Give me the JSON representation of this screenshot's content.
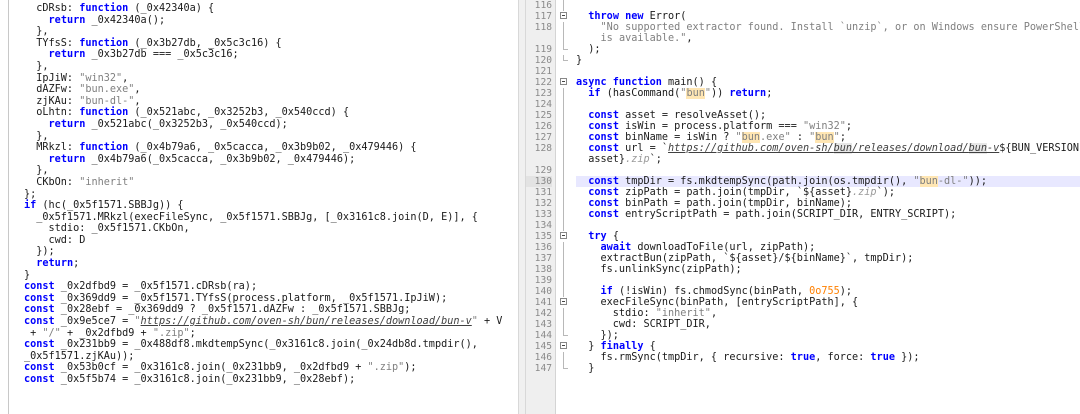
{
  "left_pane": {
    "lines": [
      {
        "seg": [
          {
            "t": "  cDRsb: "
          },
          {
            "t": "function",
            "c": "kw"
          },
          {
            "t": " (_0x42340a) {"
          }
        ]
      },
      {
        "seg": [
          {
            "t": "    "
          },
          {
            "t": "return",
            "c": "kw"
          },
          {
            "t": " _0x42340a();"
          }
        ]
      },
      {
        "seg": [
          {
            "t": "  },"
          }
        ]
      },
      {
        "seg": [
          {
            "t": "  TYfsS: "
          },
          {
            "t": "function",
            "c": "kw"
          },
          {
            "t": " (_0x3b27db, _0x5c3c16) {"
          }
        ]
      },
      {
        "seg": [
          {
            "t": "    "
          },
          {
            "t": "return",
            "c": "kw"
          },
          {
            "t": " _0x3b27db === _0x5c3c16;"
          }
        ]
      },
      {
        "seg": [
          {
            "t": "  },"
          }
        ]
      },
      {
        "seg": [
          {
            "t": "  IpJiW: "
          },
          {
            "t": "\"win32\"",
            "c": "str"
          },
          {
            "t": ","
          }
        ]
      },
      {
        "seg": [
          {
            "t": "  dAZFw: "
          },
          {
            "t": "\"bun.exe\"",
            "c": "str"
          },
          {
            "t": ","
          }
        ]
      },
      {
        "seg": [
          {
            "t": "  zjKAu: "
          },
          {
            "t": "\"bun-dl-\"",
            "c": "str"
          },
          {
            "t": ","
          }
        ]
      },
      {
        "seg": [
          {
            "t": "  oLhtn: "
          },
          {
            "t": "function",
            "c": "kw"
          },
          {
            "t": " (_0x521abc, _0x3252b3, _0x540ccd) {"
          }
        ]
      },
      {
        "seg": [
          {
            "t": "    "
          },
          {
            "t": "return",
            "c": "kw"
          },
          {
            "t": " _0x521abc(_0x3252b3, _0x540ccd);"
          }
        ]
      },
      {
        "seg": [
          {
            "t": "  },"
          }
        ]
      },
      {
        "seg": [
          {
            "t": "  MRkzl: "
          },
          {
            "t": "function",
            "c": "kw"
          },
          {
            "t": " (_0x4b79a6, _0x5cacca, _0x3b9b02, _0x479446) {"
          }
        ]
      },
      {
        "seg": [
          {
            "t": "    "
          },
          {
            "t": "return",
            "c": "kw"
          },
          {
            "t": " _0x4b79a6(_0x5cacca, _0x3b9b02, _0x479446);"
          }
        ]
      },
      {
        "seg": [
          {
            "t": "  },"
          }
        ]
      },
      {
        "seg": [
          {
            "t": "  CKbOn: "
          },
          {
            "t": "\"inherit\"",
            "c": "str"
          }
        ]
      },
      {
        "seg": [
          {
            "t": "};"
          }
        ]
      },
      {
        "seg": [
          {
            "t": "if",
            "c": "kw"
          },
          {
            "t": " (hc(_0x5f1571.SBBJg)) {"
          }
        ]
      },
      {
        "seg": [
          {
            "t": "  _0x5f1571.MRkzl(execFileSync, _0x5f1571.SBBJg, [_0x3161c8.join(D, E)], {"
          }
        ]
      },
      {
        "seg": [
          {
            "t": "    stdio: _0x5f1571.CKbOn,"
          }
        ]
      },
      {
        "seg": [
          {
            "t": "    cwd: D"
          }
        ]
      },
      {
        "seg": [
          {
            "t": "  });"
          }
        ]
      },
      {
        "seg": [
          {
            "t": "  "
          },
          {
            "t": "return",
            "c": "kw"
          },
          {
            "t": ";"
          }
        ]
      },
      {
        "seg": [
          {
            "t": "}"
          }
        ]
      },
      {
        "seg": [
          {
            "t": "const",
            "c": "kw"
          },
          {
            "t": " _0x2dfbd9 = _0x5f1571.cDRsb(ra);"
          }
        ]
      },
      {
        "seg": [
          {
            "t": "const",
            "c": "kw"
          },
          {
            "t": " _0x369dd9 = _0x5f1571.TYfsS(process.platform, _0x5f1571.IpJiW);"
          }
        ]
      },
      {
        "seg": [
          {
            "t": "const",
            "c": "kw"
          },
          {
            "t": " _0x28ebf = _0x369dd9 ? _0x5f1571.dAZFw : _0x5f1571.SBBJg;"
          }
        ]
      },
      {
        "seg": [
          {
            "t": "const",
            "c": "kw"
          },
          {
            "t": " _0x9e5ce7 = "
          },
          {
            "t": "\"",
            "c": "str"
          },
          {
            "t": "https://github.com/oven-sh/bun/releases/download/bun-v",
            "c": "url"
          },
          {
            "t": "\"",
            "c": "str"
          },
          {
            "t": " + V"
          }
        ]
      },
      {
        "seg": [
          {
            "t": " + "
          },
          {
            "t": "\"/\"",
            "c": "str"
          },
          {
            "t": " + _0x2dfbd9 + "
          },
          {
            "t": "\".zip\"",
            "c": "str"
          },
          {
            "t": ";"
          }
        ]
      },
      {
        "seg": [
          {
            "t": "const",
            "c": "kw"
          },
          {
            "t": " _0x231bb9 = _0x488df8.mkdtempSync(_0x3161c8.join(_0x24db8d.tmpdir(),"
          }
        ]
      },
      {
        "seg": [
          {
            "t": "_0x5f1571.zjKAu));"
          }
        ]
      },
      {
        "seg": [
          {
            "t": "const",
            "c": "kw"
          },
          {
            "t": " _0x53b0cf = _0x3161c8.join(_0x231bb9, _0x2dfbd9 + "
          },
          {
            "t": "\".zip\"",
            "c": "str"
          },
          {
            "t": ");"
          }
        ]
      },
      {
        "seg": [
          {
            "t": "const",
            "c": "kw"
          },
          {
            "t": " _0x5f5b74 = _0x3161c8.join(_0x231bb9, _0x28ebf);"
          }
        ]
      }
    ]
  },
  "right_pane": {
    "lines": [
      {
        "n": "116",
        "fold": "line",
        "seg": [
          {
            "t": ""
          }
        ]
      },
      {
        "n": "117",
        "fold": "box",
        "seg": [
          {
            "t": "  "
          },
          {
            "t": "throw new",
            "c": "kw"
          },
          {
            "t": " Error("
          }
        ]
      },
      {
        "n": "118",
        "fold": "line",
        "tall": true,
        "seg": [
          {
            "t": "    "
          },
          {
            "t": "\"No supported extractor found. Install `unzip`, or on Windows ensure PowerShell",
            "c": "str"
          },
          {
            "t": "\n    "
          },
          {
            "t": "is available.\"",
            "c": "str"
          },
          {
            "t": ","
          }
        ]
      },
      {
        "n": "119",
        "fold": "end",
        "seg": [
          {
            "t": "  );"
          }
        ]
      },
      {
        "n": "120",
        "fold": "end",
        "seg": [
          {
            "t": "}"
          }
        ]
      },
      {
        "n": "121",
        "fold": "",
        "seg": [
          {
            "t": ""
          }
        ]
      },
      {
        "n": "122",
        "fold": "box",
        "seg": [
          {
            "t": "async function",
            "c": "kw"
          },
          {
            "t": " main() {"
          }
        ]
      },
      {
        "n": "123",
        "fold": "line",
        "seg": [
          {
            "t": "  "
          },
          {
            "t": "if",
            "c": "kw"
          },
          {
            "t": " (hasCommand("
          },
          {
            "t": "\"",
            "c": "str"
          },
          {
            "t": "bun",
            "c": "strhl"
          },
          {
            "t": "\"",
            "c": "str"
          },
          {
            "t": ")) "
          },
          {
            "t": "return",
            "c": "kw"
          },
          {
            "t": ";"
          }
        ]
      },
      {
        "n": "124",
        "fold": "line",
        "seg": [
          {
            "t": ""
          }
        ]
      },
      {
        "n": "125",
        "fold": "line",
        "seg": [
          {
            "t": "  "
          },
          {
            "t": "const",
            "c": "kw"
          },
          {
            "t": " asset = resolveAsset();"
          }
        ]
      },
      {
        "n": "126",
        "fold": "line",
        "seg": [
          {
            "t": "  "
          },
          {
            "t": "const",
            "c": "kw"
          },
          {
            "t": " isWin = process.platform === "
          },
          {
            "t": "\"win32\"",
            "c": "str"
          },
          {
            "t": ";"
          }
        ]
      },
      {
        "n": "127",
        "fold": "line",
        "seg": [
          {
            "t": "  "
          },
          {
            "t": "const",
            "c": "kw"
          },
          {
            "t": " binName = isWin ? "
          },
          {
            "t": "\"",
            "c": "str"
          },
          {
            "t": "bun",
            "c": "strhl"
          },
          {
            "t": ".exe\"",
            "c": "str"
          },
          {
            "t": " : "
          },
          {
            "t": "\"",
            "c": "str"
          },
          {
            "t": "bun",
            "c": "strhl"
          },
          {
            "t": "\"",
            "c": "str"
          },
          {
            "t": ";"
          }
        ]
      },
      {
        "n": "128",
        "fold": "line",
        "tall": true,
        "seg": [
          {
            "t": "  "
          },
          {
            "t": "const",
            "c": "kw"
          },
          {
            "t": " url = `"
          },
          {
            "t": "https://github.com/oven-sh/",
            "c": "url"
          },
          {
            "t": "bun",
            "c": "urlhl"
          },
          {
            "t": "/releases/download/",
            "c": "url"
          },
          {
            "t": "bun",
            "c": "urlhl"
          },
          {
            "t": "-v",
            "c": "url"
          },
          {
            "t": "${BUN_VERSION}/${"
          },
          {
            "t": "\n  asset}"
          },
          {
            "t": ".zip",
            "c": "ghost"
          },
          {
            "t": "`;"
          }
        ]
      },
      {
        "n": "129",
        "fold": "line",
        "seg": [
          {
            "t": ""
          }
        ]
      },
      {
        "n": "130",
        "fold": "line",
        "hl": true,
        "seg": [
          {
            "t": "  "
          },
          {
            "t": "const",
            "c": "kw"
          },
          {
            "t": " tmpDir = fs.mkdtempSync(path.join(os.tmpdir(), "
          },
          {
            "t": "\"",
            "c": "str"
          },
          {
            "t": "bun",
            "c": "strhl"
          },
          {
            "t": "-dl-\"",
            "c": "str"
          },
          {
            "t": "));"
          }
        ]
      },
      {
        "n": "131",
        "fold": "line",
        "seg": [
          {
            "t": "  "
          },
          {
            "t": "const",
            "c": "kw"
          },
          {
            "t": " zipPath = path.join(tmpDir, `${asset}"
          },
          {
            "t": ".zip",
            "c": "ghost"
          },
          {
            "t": "`);"
          }
        ]
      },
      {
        "n": "132",
        "fold": "line",
        "seg": [
          {
            "t": "  "
          },
          {
            "t": "const",
            "c": "kw"
          },
          {
            "t": " binPath = path.join(tmpDir, binName);"
          }
        ]
      },
      {
        "n": "133",
        "fold": "line",
        "seg": [
          {
            "t": "  "
          },
          {
            "t": "const",
            "c": "kw"
          },
          {
            "t": " entryScriptPath = path.join(SCRIPT_DIR, ENTRY_SCRIPT);"
          }
        ]
      },
      {
        "n": "134",
        "fold": "line",
        "seg": [
          {
            "t": ""
          }
        ]
      },
      {
        "n": "135",
        "fold": "box",
        "seg": [
          {
            "t": "  "
          },
          {
            "t": "try",
            "c": "kw"
          },
          {
            "t": " {"
          }
        ]
      },
      {
        "n": "136",
        "fold": "line",
        "seg": [
          {
            "t": "    "
          },
          {
            "t": "await",
            "c": "kw"
          },
          {
            "t": " downloadToFile(url, zipPath);"
          }
        ]
      },
      {
        "n": "137",
        "fold": "line",
        "seg": [
          {
            "t": "    extractBun(zipPath, `${asset}/${binName}`, tmpDir);"
          }
        ]
      },
      {
        "n": "138",
        "fold": "line",
        "seg": [
          {
            "t": "    fs.unlinkSync(zipPath);"
          }
        ]
      },
      {
        "n": "139",
        "fold": "line",
        "seg": [
          {
            "t": ""
          }
        ]
      },
      {
        "n": "140",
        "fold": "line",
        "seg": [
          {
            "t": "    "
          },
          {
            "t": "if",
            "c": "kw"
          },
          {
            "t": " (!isWin) fs.chmodSync(binPath, "
          },
          {
            "t": "0o755",
            "c": "num-lit"
          },
          {
            "t": ");"
          }
        ]
      },
      {
        "n": "141",
        "fold": "box",
        "seg": [
          {
            "t": "    execFileSync(binPath, [entryScriptPath], {"
          }
        ]
      },
      {
        "n": "142",
        "fold": "line",
        "seg": [
          {
            "t": "      stdio: "
          },
          {
            "t": "\"inherit\"",
            "c": "str"
          },
          {
            "t": ","
          }
        ]
      },
      {
        "n": "143",
        "fold": "line",
        "seg": [
          {
            "t": "      cwd: SCRIPT_DIR,"
          }
        ]
      },
      {
        "n": "144",
        "fold": "end",
        "seg": [
          {
            "t": "    });"
          }
        ]
      },
      {
        "n": "145",
        "fold": "box",
        "seg": [
          {
            "t": "  } "
          },
          {
            "t": "finally",
            "c": "kw"
          },
          {
            "t": " {"
          }
        ]
      },
      {
        "n": "146",
        "fold": "line",
        "seg": [
          {
            "t": "    fs.rmSync(tmpDir, { recursive: "
          },
          {
            "t": "true",
            "c": "kw"
          },
          {
            "t": ", force: "
          },
          {
            "t": "true",
            "c": "kw"
          },
          {
            "t": " });"
          }
        ]
      },
      {
        "n": "147",
        "fold": "end",
        "seg": [
          {
            "t": "  }"
          }
        ]
      }
    ]
  }
}
